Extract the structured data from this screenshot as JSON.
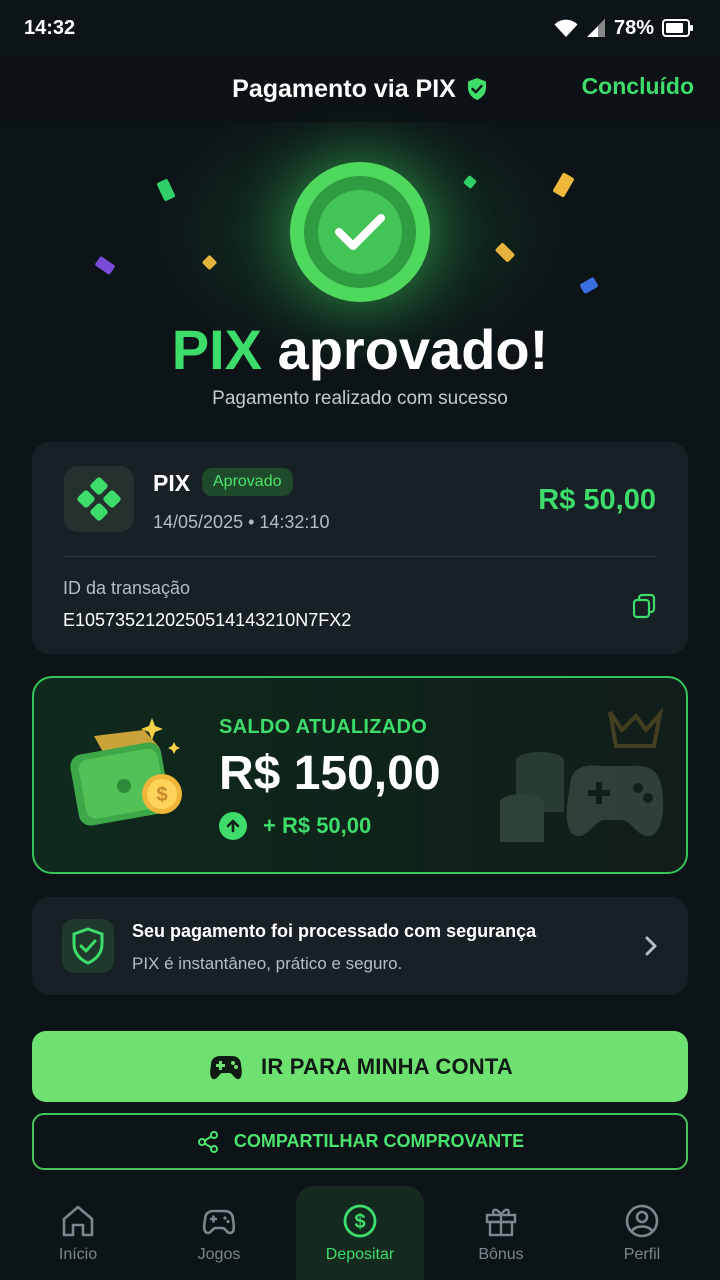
{
  "status_bar": {
    "time": "14:32",
    "battery": "78%"
  },
  "header": {
    "title": "Pagamento via PIX",
    "done_label": "Concluído"
  },
  "hero": {
    "title_highlight": "PIX",
    "title_rest": "aprovado!",
    "subtitle": "Pagamento realizado com sucesso"
  },
  "transaction": {
    "method": "PIX",
    "status": "Aprovado",
    "datetime": "14/05/2025 • 14:32:10",
    "amount": "R$ 50,00",
    "id_label": "ID da transação",
    "id_value": "E10573521202505141432 10N7FX2"
  },
  "balance": {
    "label": "SALDO ATUALIZADO",
    "value": "R$ 150,00",
    "delta": "+ R$ 50,00"
  },
  "security": {
    "title": "Seu pagamento foi processado com segurança",
    "subtitle": "PIX é instantâneo, prático e seguro."
  },
  "actions": {
    "primary": "IR PARA MINHA CONTA",
    "secondary": "COMPARTILHAR COMPROVANTE"
  },
  "nav": [
    {
      "label": "Início"
    },
    {
      "label": "Jogos"
    },
    {
      "label": "Depositar"
    },
    {
      "label": "Bônus"
    },
    {
      "label": "Perfil"
    }
  ],
  "colors": {
    "accent": "#3ddc6b",
    "background": "#0d1418",
    "card": "#172025",
    "button": "#6ee171"
  }
}
